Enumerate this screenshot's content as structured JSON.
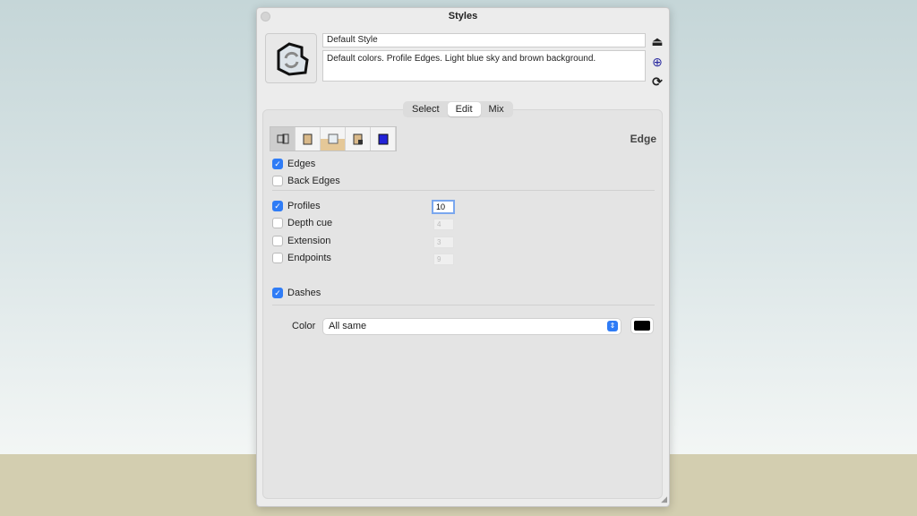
{
  "window": {
    "title": "Styles"
  },
  "style": {
    "name": "Default Style",
    "description": "Default colors. Profile Edges. Light blue sky and brown background."
  },
  "tabs": [
    {
      "label": "Select"
    },
    {
      "label": "Edit",
      "active": true
    },
    {
      "label": "Mix"
    }
  ],
  "toolbar": {
    "icons": [
      "edge-settings-icon",
      "face-settings-icon",
      "background-settings-icon",
      "watermark-settings-icon",
      "modeling-settings-icon"
    ],
    "active": 0
  },
  "section": {
    "title": "Edge"
  },
  "options": [
    {
      "label": "Edges",
      "checked": true
    },
    {
      "label": "Back Edges",
      "checked": false
    },
    {
      "label": "Profiles",
      "checked": true,
      "value": "10"
    },
    {
      "label": "Depth cue",
      "checked": false,
      "value": "4"
    },
    {
      "label": "Extension",
      "checked": false,
      "value": "3"
    },
    {
      "label": "Endpoints",
      "checked": false,
      "value": "9"
    },
    {
      "label": "Dashes",
      "checked": true
    }
  ],
  "color": {
    "label": "Color",
    "selected": "All same",
    "swatch": "#000000"
  },
  "colors": {
    "accent": "#2f7cf6"
  }
}
